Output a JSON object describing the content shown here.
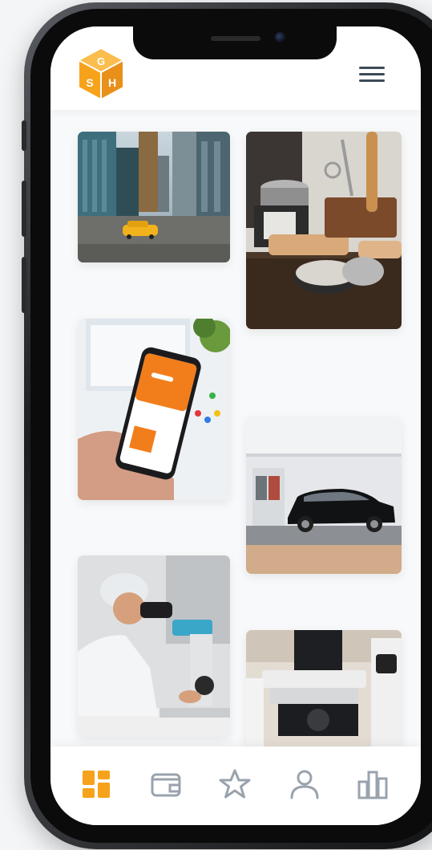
{
  "app": {
    "logo": {
      "icon": "gsh-hexagon-logo",
      "letters": "GSH"
    },
    "menu": {
      "icon": "hamburger-menu-icon"
    }
  },
  "gallery": {
    "items": [
      {
        "subject": "city-street-with-yellow-taxi"
      },
      {
        "subject": "barber-grooming-products-on-wooden-table"
      },
      {
        "subject": "hand-holding-phone-with-orange-app"
      },
      {
        "subject": "black-sedan-at-gas-station"
      },
      {
        "subject": "scientist-looking-through-microscope"
      },
      {
        "subject": "laboratory-microscope-close-up"
      }
    ]
  },
  "tabs": [
    {
      "icon": "dashboard-grid-icon",
      "active": true
    },
    {
      "icon": "wallet-icon",
      "active": false
    },
    {
      "icon": "star-icon",
      "active": false
    },
    {
      "icon": "user-icon",
      "active": false
    },
    {
      "icon": "bar-chart-icon",
      "active": false
    }
  ],
  "colors": {
    "accent": "#f7a21b",
    "inactive_icon": "#9aa3ad",
    "menu_icon": "#3c4a57"
  }
}
